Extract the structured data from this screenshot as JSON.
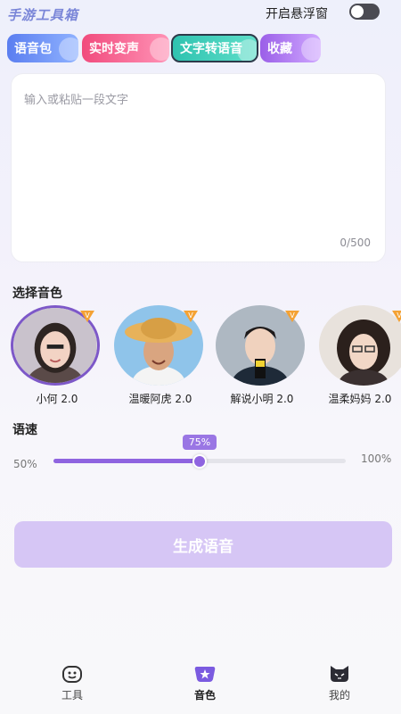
{
  "header": {
    "app_title": "手游工具箱",
    "float_window_label": "开启悬浮窗",
    "float_window_enabled": false
  },
  "tabs": [
    {
      "label": "语音包"
    },
    {
      "label": "实时变声"
    },
    {
      "label": "文字转语音"
    },
    {
      "label": "收藏"
    }
  ],
  "text_input": {
    "placeholder": "输入或粘贴一段文字",
    "count": "0/500"
  },
  "voice_section": {
    "title": "选择音色",
    "voices": [
      {
        "name": "小何 2.0",
        "selected": true,
        "badge": "vip-icon"
      },
      {
        "name": "温暖阿虎 2.0",
        "selected": false,
        "badge": "vip-icon"
      },
      {
        "name": "解说小明 2.0",
        "selected": false,
        "badge": "vip-icon"
      },
      {
        "name": "温柔妈妈 2.0",
        "selected": false,
        "badge": "vip-icon"
      }
    ]
  },
  "speed": {
    "title": "语速",
    "min_label": "50%",
    "max_label": "100%",
    "value_label": "75%",
    "value": 0.5
  },
  "generate_button": {
    "label": "生成语音"
  },
  "bottom_nav": [
    {
      "label": "工具",
      "icon": "tool-face-icon"
    },
    {
      "label": "音色",
      "icon": "voice-star-icon",
      "active": true
    },
    {
      "label": "我的",
      "icon": "cat-face-icon"
    }
  ],
  "colors": {
    "accent": "#8f64e0",
    "button_disabled": "#d6c6f5"
  }
}
